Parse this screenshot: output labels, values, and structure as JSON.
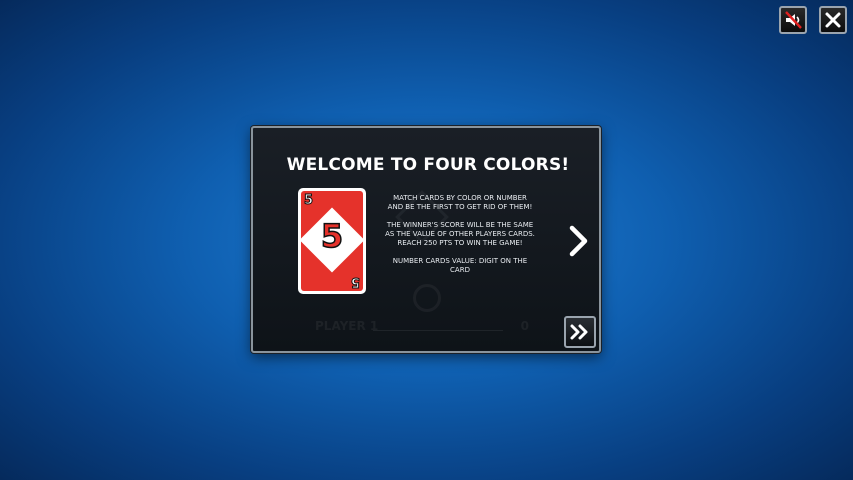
{
  "toolbar": {
    "sound_icon": "sound-muted-icon",
    "close_icon": "close-icon"
  },
  "dialog": {
    "title": "WELCOME TO FOUR COLORS!",
    "card": {
      "value": "5",
      "color": "#e5322b"
    },
    "rules": [
      "MATCH CARDS BY COLOR OR NUMBER AND BE THE FIRST TO GET RID OF THEM!",
      "THE WINNER'S SCORE WILL BE THE SAME AS THE VALUE OF OTHER PLAYERS CARDS. REACH 250 PTS TO WIN THE GAME!",
      "NUMBER CARDS VALUE: DIGIT ON THE CARD"
    ],
    "background_player": "PLAYER 1",
    "background_score": "0",
    "next_icon": "chevron-right-icon",
    "skip_icon": "double-chevron-right-icon"
  }
}
